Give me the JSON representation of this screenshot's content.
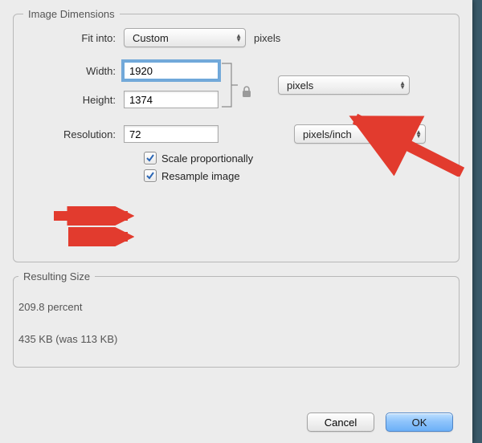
{
  "sections": {
    "dimensions_title": "Image Dimensions",
    "resulting_title": "Resulting Size"
  },
  "fit_into": {
    "label": "Fit into:",
    "value": "Custom",
    "suffix": "pixels"
  },
  "width": {
    "label": "Width:",
    "value": "1920"
  },
  "height": {
    "label": "Height:",
    "value": "1374"
  },
  "wh_unit": {
    "value": "pixels"
  },
  "resolution": {
    "label": "Resolution:",
    "value": "72",
    "unit": "pixels/inch"
  },
  "scale_proportionally": {
    "label": "Scale proportionally",
    "checked": true
  },
  "resample_image": {
    "label": "Resample image",
    "checked": true
  },
  "result": {
    "percent": "209.8 percent",
    "size": "435 KB (was 113 KB)"
  },
  "buttons": {
    "cancel": "Cancel",
    "ok": "OK"
  }
}
